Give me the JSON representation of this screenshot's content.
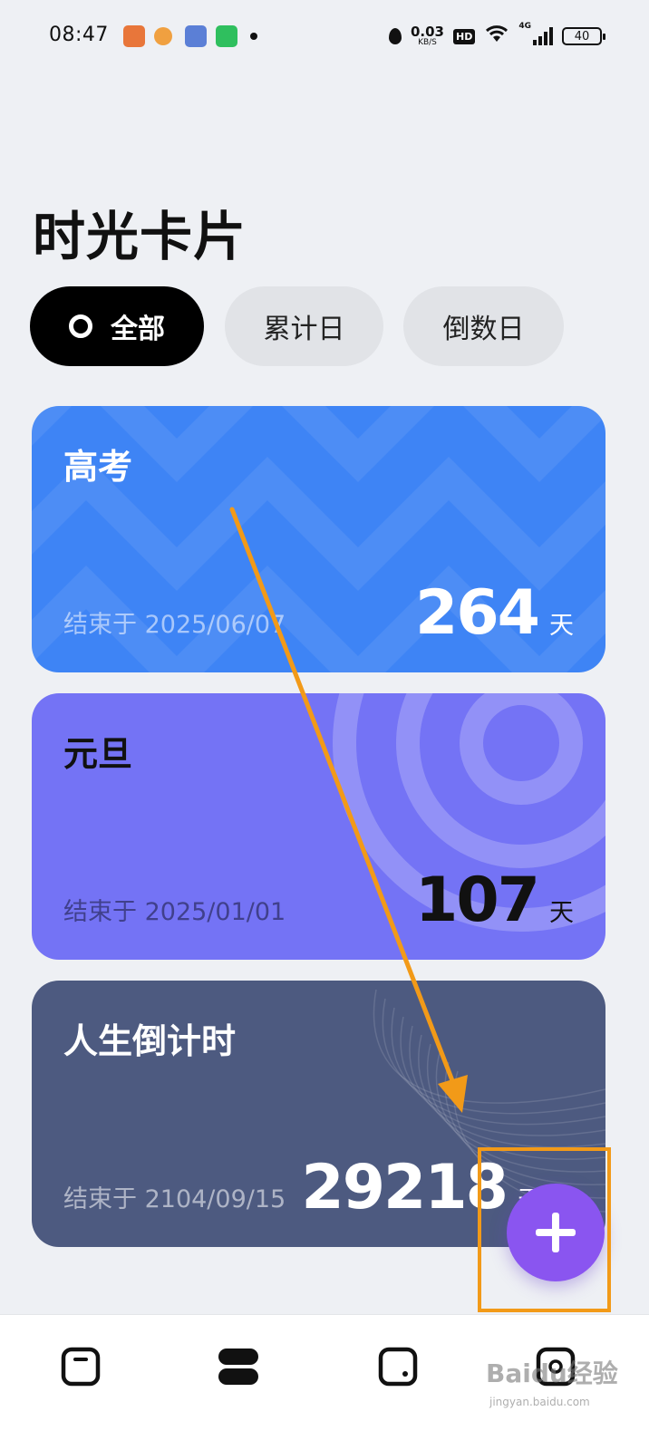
{
  "status_bar": {
    "time": "08:47",
    "net_speed_value": "0.03",
    "net_speed_unit": "KB/S",
    "hd_label": "HD",
    "signal_label": "4G",
    "battery": "40"
  },
  "page": {
    "title": "时光卡片"
  },
  "tabs": [
    {
      "label": "全部",
      "selected": true
    },
    {
      "label": "累计日",
      "selected": false
    },
    {
      "label": "倒数日",
      "selected": false
    }
  ],
  "cards": [
    {
      "name": "高考",
      "end_text": "结束于 2025/06/07",
      "days": "264",
      "unit": "天",
      "color": "#3e84f5"
    },
    {
      "name": "元旦",
      "end_text": "结束于 2025/01/01",
      "days": "107",
      "unit": "天",
      "color": "#7473f5"
    },
    {
      "name": "人生倒计时",
      "end_text": "结束于 2104/09/15",
      "days": "29218",
      "unit": "天",
      "color": "#4d5a80"
    }
  ],
  "fab": {
    "icon": "plus-icon",
    "color": "#8a55f0"
  },
  "bottom_nav": [
    {
      "icon": "card-single-icon"
    },
    {
      "icon": "card-list-icon"
    },
    {
      "icon": "card-square-icon"
    },
    {
      "icon": "card-add-icon"
    }
  ],
  "watermark": {
    "text": "Baidu经验",
    "sub": "jingyan.baidu.com"
  },
  "annotation": {
    "color": "#f29a18"
  }
}
